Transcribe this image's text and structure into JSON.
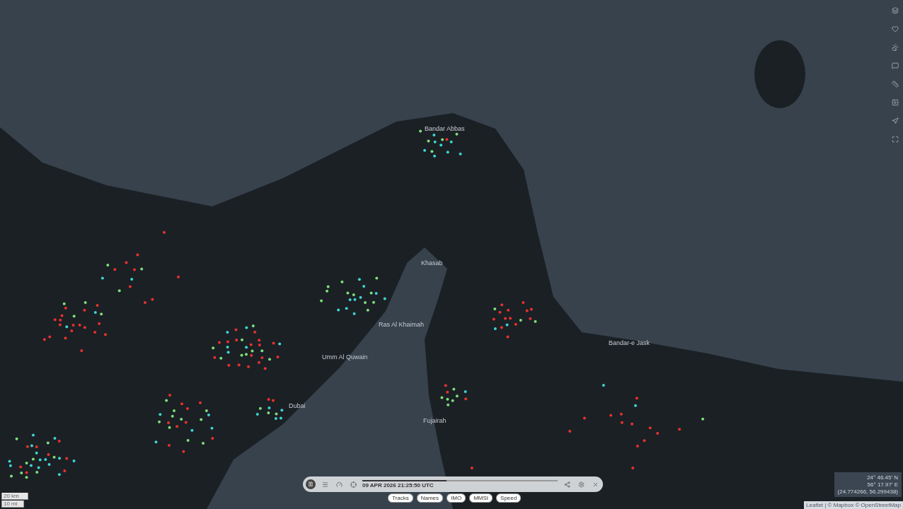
{
  "map": {
    "places": [
      "Bandar Abbas",
      "Khasab",
      "Ras Al Khaimah",
      "Umm Al Quwain",
      "Dubai",
      "Fujairah",
      "Bandar-e Jask"
    ]
  },
  "playback": {
    "playing": true,
    "timestamp": "09 APR 2026 21:25:50 UTC",
    "level": 0.43,
    "toggles": [
      {
        "label": "Tracks",
        "selected": false
      },
      {
        "label": "Names",
        "selected": false
      },
      {
        "label": "IMO",
        "selected": false
      },
      {
        "label": "MMSI",
        "selected": false
      },
      {
        "label": "Speed",
        "selected": false
      }
    ]
  },
  "coordinates": {
    "lat": "24° 46.45' N",
    "lon": "56° 17.97' E",
    "decimal": "(24.774266, 56.299438)"
  },
  "scale": {
    "metric": "20 km",
    "imperial": "10 mi"
  },
  "attribution": "Leaflet | © Mapbox © OpenStreetMap"
}
